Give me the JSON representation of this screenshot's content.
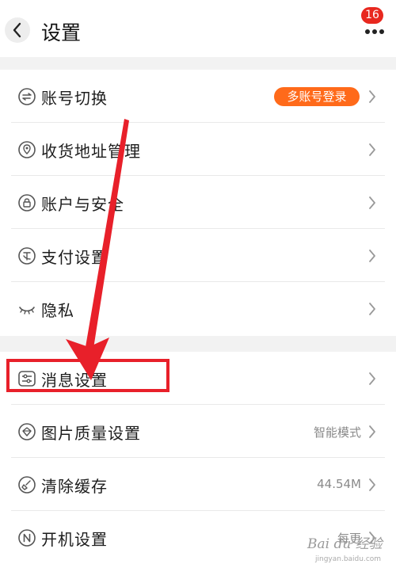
{
  "header": {
    "title": "设置",
    "badge_count": "16"
  },
  "settings": {
    "group1": [
      {
        "label": "账号切换",
        "icon": "account-switch-icon",
        "tag": "多账号登录"
      },
      {
        "label": "收货地址管理",
        "icon": "location-pin-icon"
      },
      {
        "label": "账户与安全",
        "icon": "lock-icon"
      },
      {
        "label": "支付设置",
        "icon": "payment-icon"
      },
      {
        "label": "隐私",
        "icon": "eye-closed-icon"
      }
    ],
    "group2": [
      {
        "label": "消息设置",
        "icon": "message-settings-icon"
      },
      {
        "label": "图片质量设置",
        "icon": "image-quality-icon",
        "value": "智能模式"
      },
      {
        "label": "清除缓存",
        "icon": "broom-icon",
        "value": "44.54M"
      },
      {
        "label": "开机设置",
        "icon": "startup-icon",
        "value": "每更"
      }
    ]
  },
  "watermark": {
    "text": "Bai du 经验",
    "url": "jingyan.baidu.com"
  },
  "colors": {
    "accent": "#ff6a1a",
    "highlight": "#e8202a",
    "badge": "#e8281f"
  }
}
